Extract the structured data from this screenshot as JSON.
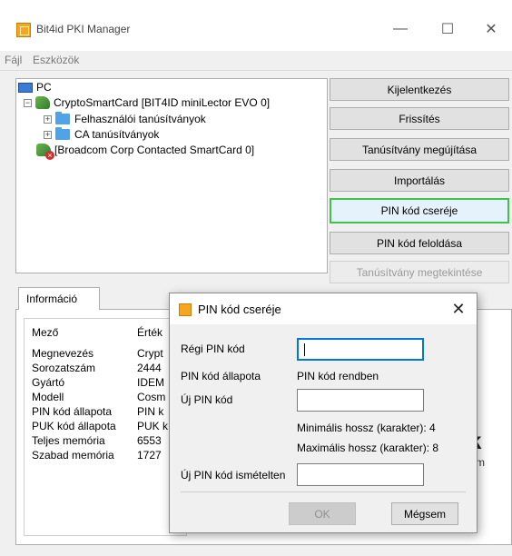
{
  "window": {
    "title": "Bit4id PKI Manager",
    "minimize_glyph": "—",
    "maximize_glyph": "☐",
    "close_glyph": "✕"
  },
  "menu": [
    "Fájl",
    "Eszközök"
  ],
  "tree": {
    "root": "PC",
    "card1": "CryptoSmartCard [BIT4ID miniLector EVO 0]",
    "folder1": "Felhasználói tanúsítványok",
    "folder2": "CA tanúsítványok",
    "card2": "[Broadcom Corp Contacted SmartCard 0]"
  },
  "side_buttons": [
    "Kijelentkezés",
    "Frissítés",
    "Tanúsítvány megújítása",
    "Importálás",
    "PIN kód cseréje",
    "PIN kód feloldása",
    "Tanúsítvány megtekintése"
  ],
  "info": {
    "tab": "Információ",
    "col_field": "Mező",
    "col_value": "Érték",
    "rows": [
      {
        "field": "Megnevezés",
        "value": "Crypt"
      },
      {
        "field": "Sorozatszám",
        "value": "2444"
      },
      {
        "field": "Gyártó",
        "value": "IDEM"
      },
      {
        "field": "Modell",
        "value": "Cosm"
      },
      {
        "field": "PIN kód állapota",
        "value": "PIN k"
      },
      {
        "field": "PUK kód állapota",
        "value": "PUK k"
      },
      {
        "field": "Teljes memória",
        "value": "6553"
      },
      {
        "field": "Szabad memória",
        "value": "1727"
      }
    ],
    "brand_fragment_1": "k",
    "brand_fragment_2": "m"
  },
  "dialog": {
    "title": "PIN kód cseréje",
    "old_pin_label": "Régi PIN kód",
    "pin_status_label": "PIN kód állapota",
    "pin_status_value": "PIN kód rendben",
    "new_pin_label": "Új PIN kód",
    "min_len": "Minimális hossz (karakter): 4",
    "max_len": "Maximális hossz (karakter): 8",
    "repeat_label": "Új PIN kód ismételten",
    "ok": "OK",
    "cancel": "Mégsem",
    "close_glyph": "✕"
  },
  "colors": {
    "focus_green": "#3cc34a",
    "input_focus_blue": "#0078d7",
    "app_icon_orange": "#f5a623"
  }
}
